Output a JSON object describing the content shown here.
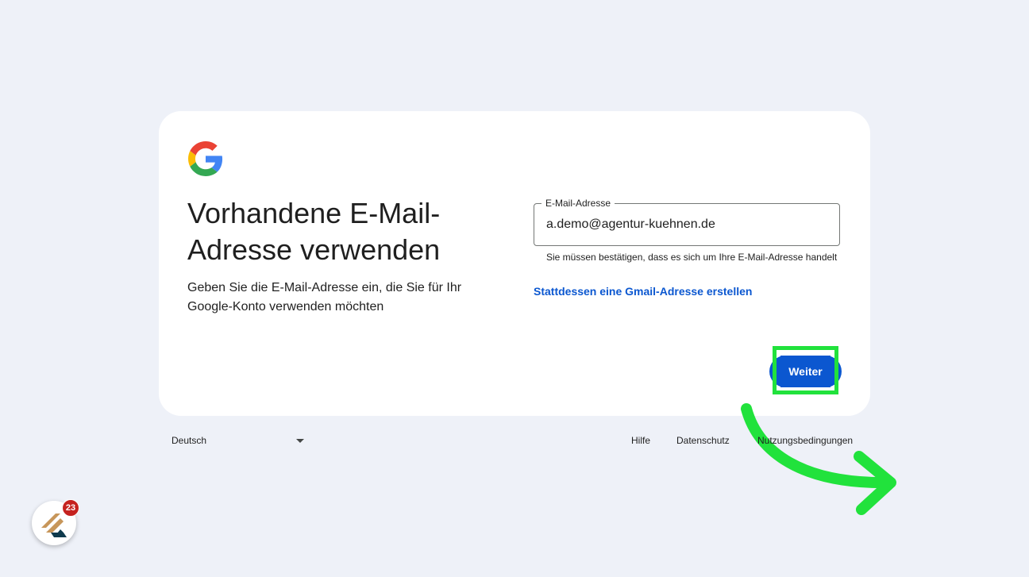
{
  "heading": {
    "title": "Vorhandene E-Mail-Adresse verwenden",
    "subtitle": "Geben Sie die E-Mail-Adresse ein, die Sie für Ihr Google-Konto verwenden möchten"
  },
  "email_field": {
    "label": "E-Mail-Adresse",
    "value": "a.demo@agentur-kuehnen.de",
    "helper": "Sie müssen bestätigen, dass es sich um Ihre E-Mail-Adresse handelt"
  },
  "alt_link": "Stattdessen eine Gmail-Adresse erstellen",
  "next_button": "Weiter",
  "footer": {
    "language": "Deutsch",
    "links": [
      "Hilfe",
      "Datenschutz",
      "Nutzungsbedingungen"
    ]
  },
  "extension": {
    "badge_count": "23"
  },
  "colors": {
    "accent": "#0b57d0",
    "highlight": "#21e23c",
    "background": "#eef1f8"
  },
  "icons": [
    "google-logo-icon",
    "dropdown-caret-icon",
    "annotation-arrow-icon",
    "extension-logo-icon"
  ]
}
